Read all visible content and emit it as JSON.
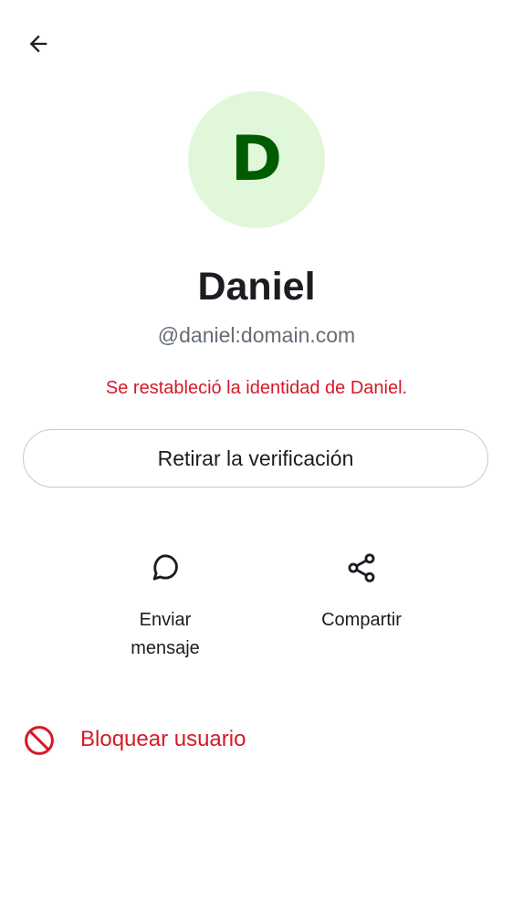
{
  "header": {
    "back_icon": "arrow-left-icon"
  },
  "profile": {
    "avatar_initial": "D",
    "avatar_bg_color": "#e0f8d9",
    "avatar_text_color": "#005c00",
    "display_name": "Daniel",
    "user_id": "@daniel:domain.com",
    "identity_warning": "Se restableció la identidad de Daniel."
  },
  "buttons": {
    "withdraw_verification": "Retirar la verificación"
  },
  "actions": [
    {
      "icon": "chat-bubble-icon",
      "label": "Enviar mensaje"
    },
    {
      "icon": "share-icon",
      "label": "Compartir"
    }
  ],
  "block": {
    "icon": "block-icon",
    "label": "Bloquear usuario"
  },
  "colors": {
    "critical": "#d51928",
    "text_primary": "#1b1d22",
    "text_secondary": "#656d77"
  }
}
